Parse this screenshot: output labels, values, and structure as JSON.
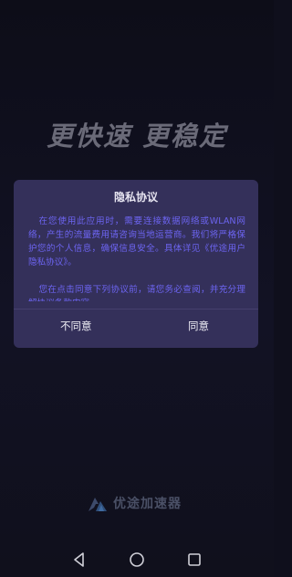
{
  "slogan": "更快速 更稳定",
  "dialog": {
    "title": "隐私协议",
    "paragraph1": "在您使用此应用时，需要连接数据网络或WLAN网络，产生的流量费用请咨询当地运营商。我们将严格保护您的个人信息，确保信息安全。具体详见《优途用户隐私协议》。",
    "paragraph2": "您在点击同意下列协议前，请您务必查阅，并充分理解协议条款内容",
    "disagree_label": "不同意",
    "agree_label": "同意"
  },
  "brand": {
    "name": "优途加速器",
    "logo_icon": "brand-logo-icon"
  },
  "navbar": {
    "back_icon": "back-triangle-icon",
    "home_icon": "home-circle-icon",
    "recent_icon": "recent-square-icon"
  },
  "colors": {
    "background": "#0f0f1c",
    "dialog_bg": "#34305a",
    "dialog_text": "#6c64f0",
    "slogan": "#6a6a78"
  }
}
